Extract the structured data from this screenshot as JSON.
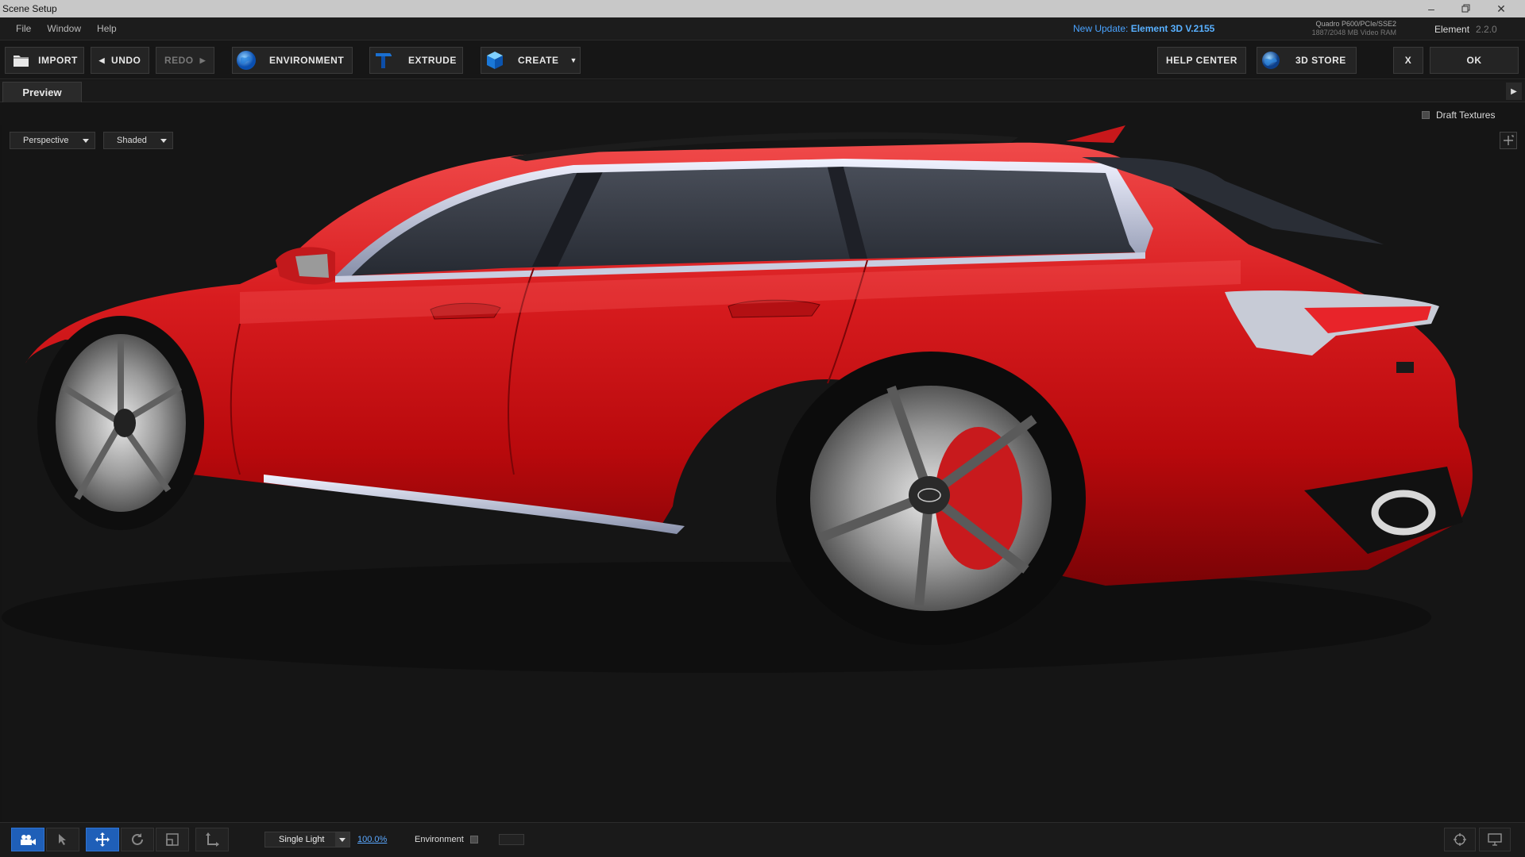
{
  "window": {
    "title": "Scene Setup"
  },
  "menu": {
    "items": [
      "File",
      "Window",
      "Help"
    ]
  },
  "update": {
    "prefix": "New Update:",
    "version": "Element 3D V.2155"
  },
  "gpu": {
    "name": "Quadro P600/PCIe/SSE2",
    "ram": "1887/2048 MB Video RAM"
  },
  "app_version": {
    "name": "Element",
    "version": "2.2.0"
  },
  "toolbar": {
    "import": "IMPORT",
    "undo": "UNDO",
    "redo": "REDO",
    "environment": "ENVIRONMENT",
    "extrude": "EXTRUDE",
    "create": "CREATE",
    "help_center": "HELP CENTER",
    "store": "3D STORE",
    "close": "X",
    "ok": "OK"
  },
  "tabs": {
    "preview": "Preview"
  },
  "options": {
    "draft_textures": "Draft Textures"
  },
  "viewport": {
    "camera": "Perspective",
    "shading": "Shaded"
  },
  "bottom": {
    "light": "Single Light",
    "light_intensity": "100.0%",
    "environment": "Environment"
  },
  "colors": {
    "accent": "#1f5fb8",
    "car_body": "#d8191c",
    "link": "#4aa3ff"
  }
}
